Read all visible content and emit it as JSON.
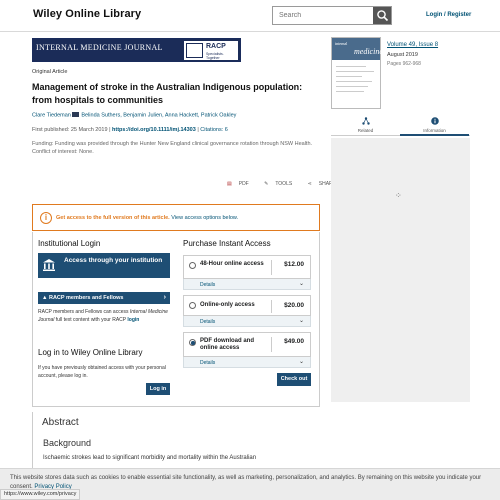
{
  "header": {
    "logo": "Wiley Online Library",
    "search_placeholder": "Search",
    "login": "Login / Register"
  },
  "banner": {
    "journal": "INTERNAL MEDICINE JOURNAL",
    "racp": "RACP",
    "racp_sub": "Specialists. Together"
  },
  "article": {
    "type": "Original Article",
    "title": "Management of stroke in the Australian Indigenous population: from hospitals to communities",
    "authors": [
      "Clare Tiedeman",
      "Belinda Suthers,",
      "Benjamin Julien,",
      "Anna Hackett,",
      "Patrick Oakley"
    ],
    "first_published_label": "First published:",
    "first_published": "25 March 2019",
    "doi": "https://doi.org/10.1111/imj.14303",
    "citations": "Citations: 6",
    "funding": "Funding: Funding was provided through the Hunter New England clinical governance rotation through NSW Health.",
    "conflict": "Conflict of interest: None."
  },
  "tools": {
    "pdf": "PDF",
    "tools": "TOOLS",
    "share": "SHARE"
  },
  "access": {
    "message": "Get access to the full version of this article.",
    "link": "View access options below."
  },
  "institutional": {
    "heading": "Institutional Login",
    "button": "Access through your institution",
    "racp_button": "RACP members and Fellows",
    "racp_desc_1": "RACP members and Fellows can access",
    "racp_desc_em": "Internal Medicine Journal",
    "racp_desc_2": "full text content with your RACP",
    "racp_login": "login"
  },
  "wiley_login": {
    "heading": "Log in to Wiley Online Library",
    "desc": "If you have previously obtained access with your personal account, please log in.",
    "button": "Log in"
  },
  "purchase": {
    "heading": "Purchase Instant Access",
    "options": [
      {
        "name": "48-Hour online access",
        "price": "$12.00",
        "details": "Details"
      },
      {
        "name": "Online-only access",
        "price": "$20.00",
        "details": "Details"
      },
      {
        "name": "PDF download and online access",
        "price": "$49.00",
        "details": "Details"
      }
    ],
    "checkout": "Check out"
  },
  "abstract": {
    "heading": "Abstract",
    "section": "Background",
    "text": "Ischaemic strokes lead to significant morbidity and mortality within the Australian"
  },
  "issue": {
    "cover_title": "internal",
    "cover_big": "medicine",
    "volume": "Volume 49, Issue 8",
    "date": "August 2019",
    "pages": "Pages 962-968"
  },
  "rail_tabs": {
    "related": "Related",
    "information": "Information"
  },
  "cookie": {
    "text": "This website stores data such as cookies to enable essential site functionality, as well as marketing, personalization, and analytics. By remaining on this website you indicate your consent.",
    "policy": "Privacy Policy"
  },
  "status_url": "https://www.wiley.com/privacy",
  "colors": {
    "accent": "#1e4e74",
    "warning": "#e07a1f",
    "link": "#005274"
  }
}
